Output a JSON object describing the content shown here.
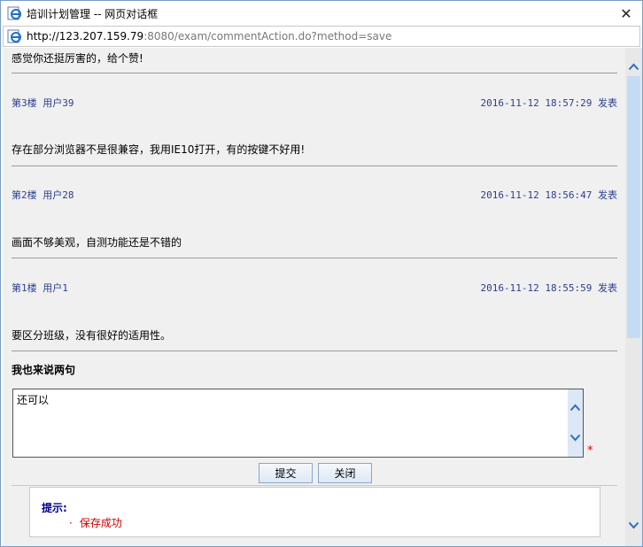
{
  "window": {
    "title": "培训计划管理 -- 网页对话框",
    "close_glyph": "✕"
  },
  "address": {
    "host": "http://123.207.159.79",
    "rest": ":8080/exam/commentAction.do?method=save"
  },
  "comments": [
    {
      "text": "感觉你还挺厉害的，给个赞!"
    },
    {
      "floor": "第3楼 用户39",
      "time": "2016-11-12 18:57:29 发表",
      "text": "存在部分浏览器不是很兼容，我用IE10打开，有的按键不好用!"
    },
    {
      "floor": "第2楼 用户28",
      "time": "2016-11-12 18:56:47 发表",
      "text": "画面不够美观，自测功能还是不错的"
    },
    {
      "floor": "第1楼 用户1",
      "time": "2016-11-12 18:55:59 发表",
      "text": "要区分班级，没有很好的适用性。"
    }
  ],
  "form": {
    "section_title": "我也来说两句",
    "textarea_value": "还可以",
    "required_mark": "*",
    "submit_label": "提交",
    "close_label": "关闭"
  },
  "notice": {
    "title": "提示:",
    "bullet": "·",
    "message": "保存成功"
  },
  "colors": {
    "meta": "#2a3f8f",
    "notice_title": "#00008b",
    "notice_message": "#cc0000",
    "content_bg": "#f0f0f0"
  }
}
